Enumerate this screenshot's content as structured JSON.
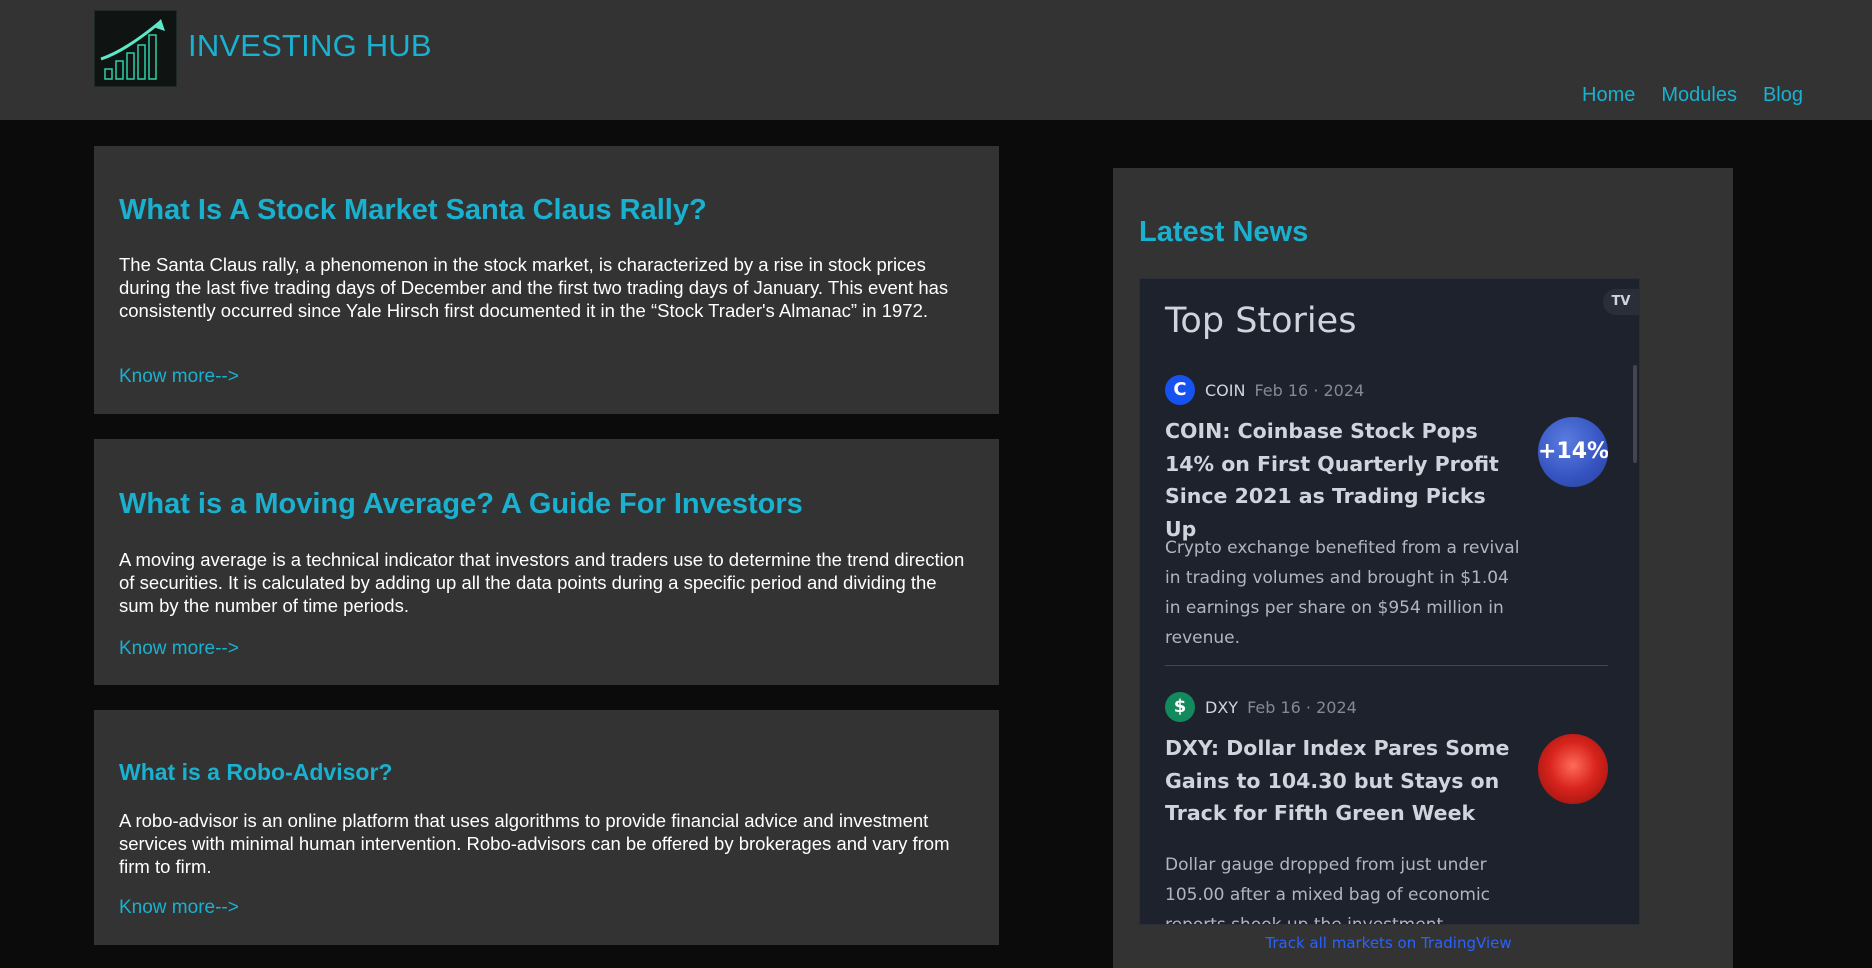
{
  "header": {
    "brand": "INVESTING HUB",
    "logo_icon": "rising-bar-chart-icon",
    "nav": [
      {
        "label": "Home"
      },
      {
        "label": "Modules"
      },
      {
        "label": "Blog"
      }
    ]
  },
  "articles": [
    {
      "title": "What Is A Stock Market Santa Claus Rally?",
      "body": "The Santa Claus rally, a phenomenon in the stock market, is characterized by a rise in stock prices during the last five trading days of December and the first two trading days of January. This event has consistently occurred since Yale Hirsch first documented it in the “Stock Trader's Almanac” in 1972.",
      "link": "Know more-->"
    },
    {
      "title": "What is a Moving Average? A Guide For Investors",
      "body": "A moving average is a technical indicator that investors and traders use to determine the trend direction of securities. It is calculated by adding up all the data points during a specific period and dividing the sum by the number of time periods.",
      "link": "Know more-->"
    },
    {
      "title": "What is a Robo-Advisor?",
      "body": "A robo-advisor is an online platform that uses algorithms to provide financial advice and investment services with minimal human intervention. Robo-advisors can be offered by brokerages and vary from firm to firm.",
      "link": "Know more-->"
    }
  ],
  "news": {
    "title": "Latest News",
    "widget": {
      "badge": "TV",
      "heading": "Top Stories",
      "stories": [
        {
          "icon_letter": "C",
          "icon_color": "#1652f0",
          "ticker": "COIN",
          "date": "Feb 16 · 2024",
          "headline": "COIN: Coinbase Stock Pops 14% on First Quarterly Profit Since 2021 as Trading Picks Up",
          "summary": "Crypto exchange benefited from a revival in trading volumes and brought in $1.04 in earnings per share on $954 million in revenue.",
          "thumb_text": "+14%"
        },
        {
          "icon_letter": "$",
          "icon_color": "#138a5e",
          "ticker": "DXY",
          "date": "Feb 16 · 2024",
          "headline": "DXY: Dollar Index Pares Some Gains to 104.30 but Stays on Track for Fifth Green Week",
          "summary": "Dollar gauge dropped from just under 105.00 after a mixed bag of economic reports shook up the investment",
          "thumb_text": ""
        }
      ],
      "footer_link": "Track all markets on TradingView"
    }
  }
}
